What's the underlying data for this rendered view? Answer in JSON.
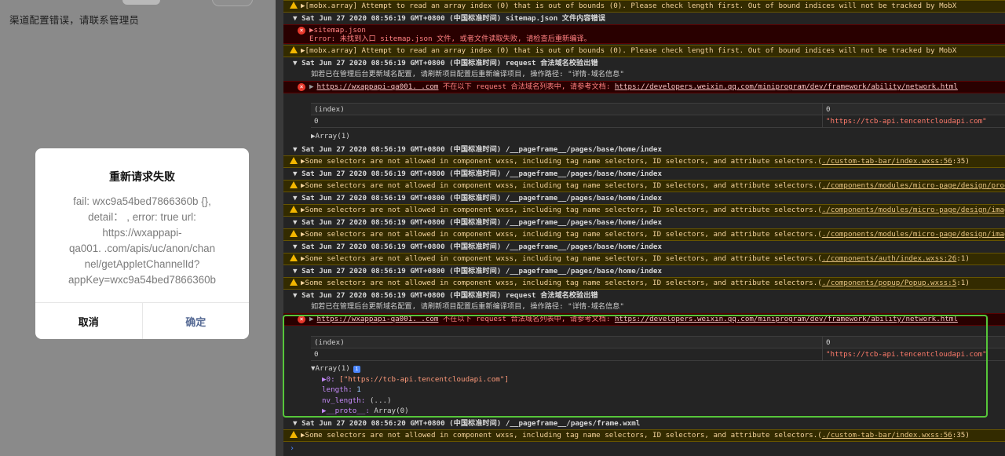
{
  "simulator": {
    "message": "渠道配置错误，请联系管理员",
    "dialog": {
      "title": "重新请求失败",
      "body": "fail: wxc9a54bed7866360b {},\ndetail：  , error: true url:\nhttps://wxappapi-\nqa001.      .com/apis/uc/anon/chan\nnel/getAppletChannelId?\nappKey=wxc9a54bed7866360b",
      "cancel_label": "取消",
      "confirm_label": "确定"
    }
  },
  "console": {
    "colors": {
      "warning_bg": "#332b00",
      "error_bg": "#290000",
      "highlight": "#56c63a"
    },
    "rows": [
      {
        "type": "warn",
        "text": "▶[mobx.array] Attempt to read an array index (0) that is out of bounds (0). Please check length first. Out of bound indices will not be tracked by MobX"
      },
      {
        "type": "group",
        "text": "▼ Sat Jun 27 2020 08:56:19 GMT+0800 (中国标准时间)  sitemap.json 文件内容错误"
      },
      {
        "type": "err2",
        "line1": "▶sitemap.json",
        "line2": "Error: 未找到入口 sitemap.json 文件, 或者文件读取失败, 请检查后重新编译。"
      },
      {
        "type": "warn",
        "text": "▶[mobx.array] Attempt to read an array index (0) that is out of bounds (0). Please check length first. Out of bound indices will not be tracked by MobX"
      },
      {
        "type": "group",
        "text": "▼ Sat Jun 27 2020 08:56:19 GMT+0800 (中国标准时间) request 合法域名校验出错"
      },
      {
        "type": "plain",
        "text": "如若已在管理后台更新域名配置, 请刷新项目配置后重新编译项目, 操作路径: \"详情-域名信息\""
      },
      {
        "type": "errlink",
        "link": "https://wxappapi-qa001.      .com",
        "mid": " 不在以下 request 合法域名列表中, 请参考文档: ",
        "doc": "https://developers.weixin.qq.com/miniprogram/dev/framework/ability/network.html"
      },
      {
        "type": "group",
        "text": "▼ Sat Jun 27 2020 08:56:19 GMT+0800 (中国标准时间) /__pageframe__/pages/base/home/index"
      },
      {
        "type": "warnlink",
        "text": "▶Some selectors are not allowed in component wxss, including tag name selectors, ID selectors, and attribute selectors.(",
        "link": "./custom-tab-bar/index.wxss:56",
        "tail": ":35)"
      },
      {
        "type": "group",
        "text": "▼ Sat Jun 27 2020 08:56:19 GMT+0800 (中国标准时间) /__pageframe__/pages/base/home/index"
      },
      {
        "type": "warnlink",
        "text": "▶Some selectors are not allowed in component wxss, including tag name selectors, ID selectors, and attribute selectors.(",
        "link": "./components/modules/micro-page/design/prod",
        "tail": ""
      },
      {
        "type": "group",
        "text": "▼ Sat Jun 27 2020 08:56:19 GMT+0800 (中国标准时间) /__pageframe__/pages/base/home/index"
      },
      {
        "type": "warnlink",
        "text": "▶Some selectors are not allowed in component wxss, including tag name selectors, ID selectors, and attribute selectors.(",
        "link": "./components/modules/micro-page/design/imag",
        "tail": ""
      },
      {
        "type": "group",
        "text": "▼ Sat Jun 27 2020 08:56:19 GMT+0800 (中国标准时间) /__pageframe__/pages/base/home/index"
      },
      {
        "type": "warnlink",
        "text": "▶Some selectors are not allowed in component wxss, including tag name selectors, ID selectors, and attribute selectors.(",
        "link": "./components/modules/micro-page/design/imag",
        "tail": ""
      },
      {
        "type": "group",
        "text": "▼ Sat Jun 27 2020 08:56:19 GMT+0800 (中国标准时间) /__pageframe__/pages/base/home/index"
      },
      {
        "type": "warnlink",
        "text": "▶Some selectors are not allowed in component wxss, including tag name selectors, ID selectors, and attribute selectors.(",
        "link": "./components/auth/index.wxss:26",
        "tail": ":1)"
      },
      {
        "type": "group",
        "text": "▼ Sat Jun 27 2020 08:56:19 GMT+0800 (中国标准时间) /__pageframe__/pages/base/home/index"
      },
      {
        "type": "warnlink",
        "text": "▶Some selectors are not allowed in component wxss, including tag name selectors, ID selectors, and attribute selectors.(",
        "link": "./components/popup/Popup.wxss:5",
        "tail": ":1)"
      },
      {
        "type": "group",
        "text": "▼ Sat Jun 27 2020 08:56:19 GMT+0800 (中国标准时间) request 合法域名校验出错"
      },
      {
        "type": "plain",
        "text": "如若已在管理后台更新域名配置, 请刷新项目配置后重新编译项目, 操作路径: \"详情-域名信息\""
      },
      {
        "type": "errlink",
        "link": "https://wxappapi-qa001.      .com",
        "mid": " 不在以下 request 合法域名列表中, 请参考文档: ",
        "doc": "https://developers.weixin.qq.com/miniprogram/dev/framework/ability/network.html"
      },
      {
        "type": "group",
        "text": "▼ Sat Jun 27 2020 08:56:20 GMT+0800 (中国标准时间) /__pageframe__/pages/frame.wxml"
      },
      {
        "type": "warnlink",
        "text": "▶Some selectors are not allowed in component wxss, including tag name selectors, ID selectors, and attribute selectors.(",
        "link": "./custom-tab-bar/index.wxss:56",
        "tail": ":35)"
      }
    ],
    "table": {
      "col1_header": "(index)",
      "col2_header": "0",
      "row_index": "0",
      "row_value": "\"https://tcb-api.tencentcloudapi.com\"",
      "array_collapsed": "▶Array(1)"
    },
    "tree": {
      "array_label": "▼Array(1)",
      "item0_key": "▶0:",
      "item0_value": "[\"https://tcb-api.tencentcloudapi.com\"]",
      "length_key": "length:",
      "length_value": "1",
      "nv_key": "nv_length:",
      "nv_value": "(...)",
      "proto_key": "▶__proto__:",
      "proto_value": "Array(0)"
    },
    "prompt": "›"
  }
}
